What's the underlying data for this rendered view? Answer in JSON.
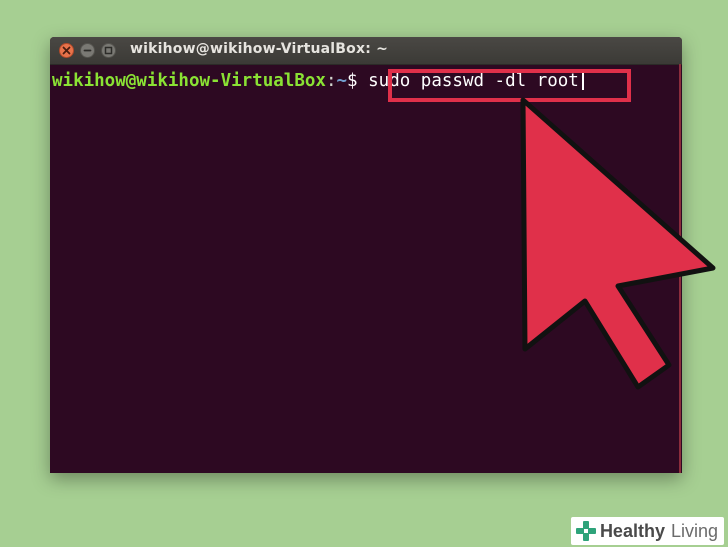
{
  "window": {
    "title": "wikihow@wikihow-VirtualBox: ~"
  },
  "terminal": {
    "prompt_user": "wikihow@wikihow-VirtualBox",
    "prompt_sep": ":",
    "prompt_path": "~",
    "prompt_dollar": "$",
    "command": "sudo passwd -dl root"
  },
  "watermark": {
    "brand_part1": "Healthy",
    "brand_part2": "Living"
  },
  "colors": {
    "background": "#a6cf92",
    "terminal_bg": "#2d0922",
    "prompt_user": "#8ae234",
    "prompt_path": "#729fcf",
    "highlight": "#e0304a"
  },
  "icons": [
    "close-icon",
    "minimize-icon",
    "maximize-icon",
    "mouse-pointer-icon",
    "cross-logo-icon"
  ]
}
